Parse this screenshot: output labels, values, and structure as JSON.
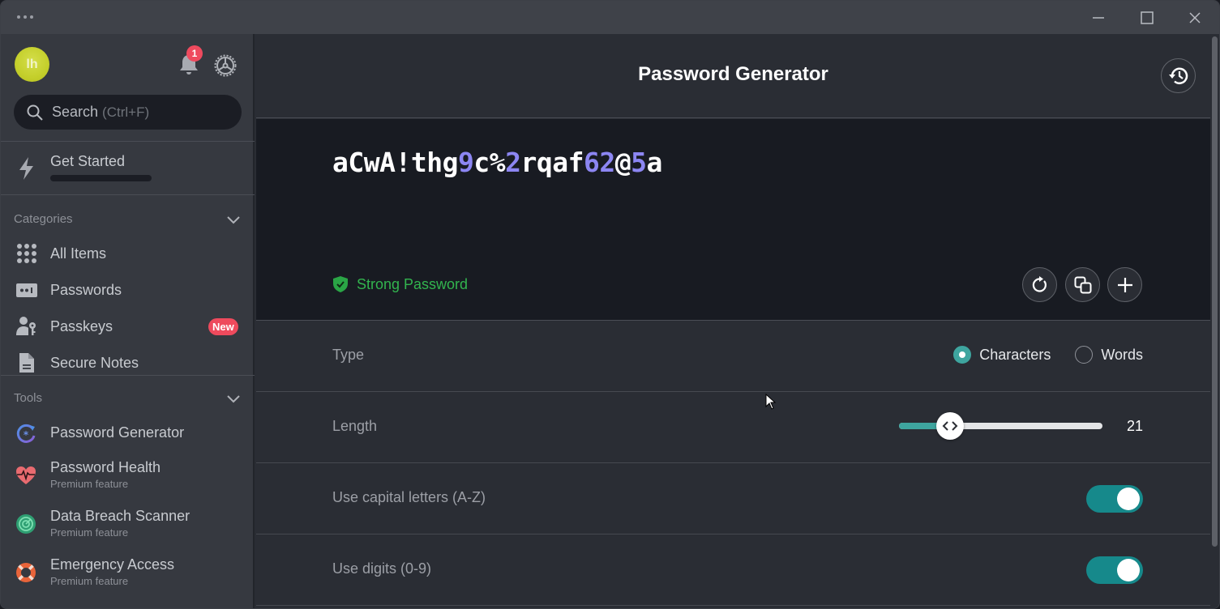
{
  "window": {
    "menu_icon": "more-dots-icon",
    "controls": [
      "minimize",
      "maximize",
      "close"
    ]
  },
  "sidebar": {
    "avatar_initials": "lh",
    "avatar_color": "#c8d32e",
    "notification_count": "1",
    "search": {
      "placeholder": "Search",
      "shortcut_hint": "(Ctrl+F)"
    },
    "get_started": {
      "label": "Get Started",
      "progress": 0
    },
    "categories": {
      "title": "Categories",
      "items": [
        {
          "label": "All Items",
          "icon": "grid-icon"
        },
        {
          "label": "Passwords",
          "icon": "password-icon"
        },
        {
          "label": "Passkeys",
          "icon": "passkey-icon",
          "badge": "New"
        },
        {
          "label": "Secure Notes",
          "icon": "note-icon"
        }
      ]
    },
    "tools": {
      "title": "Tools",
      "items": [
        {
          "label": "Password Generator",
          "icon": "password-generator-icon",
          "sub": ""
        },
        {
          "label": "Password Health",
          "icon": "heart-pulse-icon",
          "sub": "Premium feature"
        },
        {
          "label": "Data Breach Scanner",
          "icon": "radar-icon",
          "sub": "Premium feature"
        },
        {
          "label": "Emergency Access",
          "icon": "lifebuoy-icon",
          "sub": "Premium feature"
        }
      ]
    }
  },
  "main": {
    "title": "Password Generator",
    "password": {
      "value": "aCwA!thg9c%2rqaf62@5a",
      "digit_color": "#8c86f2"
    },
    "strength": {
      "label": "Strong Password",
      "color": "#32b44e"
    },
    "actions": [
      "regenerate",
      "copy",
      "add"
    ],
    "options": {
      "type": {
        "label": "Type",
        "choices": [
          {
            "label": "Characters",
            "selected": true
          },
          {
            "label": "Words",
            "selected": false
          }
        ]
      },
      "length": {
        "label": "Length",
        "value": "21",
        "slider_fraction": 0.25
      },
      "capitals": {
        "label": "Use capital letters (A-Z)",
        "enabled": true
      },
      "digits": {
        "label": "Use digits (0-9)",
        "enabled": true
      }
    },
    "accent_color": "#3ea59f"
  }
}
